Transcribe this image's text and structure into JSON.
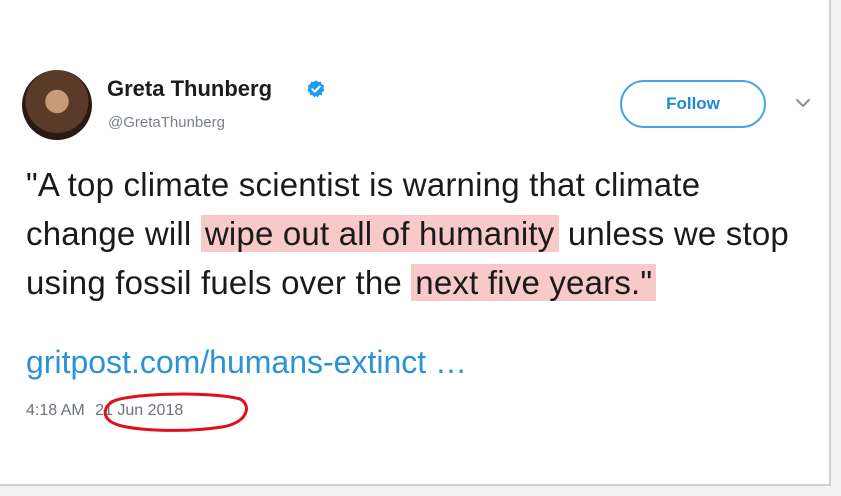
{
  "tweet": {
    "author_name": "Greta Thunberg",
    "handle": "@GretaThunberg",
    "follow_label": "Follow",
    "text_part1": "\"A top climate scientist is warning that climate change will ",
    "text_highlight1": "wipe out all of humanity",
    "text_part2": " unless we stop using fossil fuels over the ",
    "text_highlight2": "next five years.\"",
    "link": "gritpost.com/humans-extinct …",
    "time": "4:18 AM",
    "date": "21 Jun 2018"
  },
  "colors": {
    "accent": "#1d8ad6",
    "link": "#2a92d6",
    "highlight": "#f7c9c9",
    "annotation": "#e0101a"
  },
  "icons": [
    "verified-badge-icon",
    "chevron-down-icon"
  ]
}
